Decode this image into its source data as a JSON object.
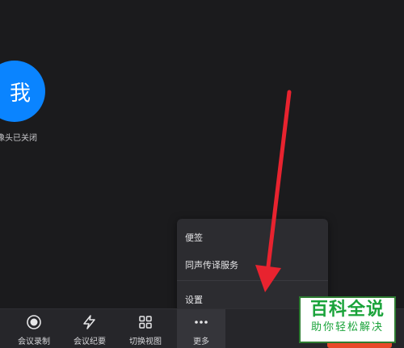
{
  "video": {
    "avatar_text": "我",
    "camera_status": "像头已关闭",
    "avatar_color": "#0a84ff"
  },
  "toolbar": {
    "items": [
      {
        "label": "会议录制",
        "icon": "record-icon"
      },
      {
        "label": "会议纪要",
        "icon": "ai-notes-icon"
      },
      {
        "label": "切换视图",
        "icon": "grid-view-icon"
      },
      {
        "label": "更多",
        "icon": "more-dots-icon"
      }
    ]
  },
  "more_menu": {
    "items": [
      {
        "label": "便签"
      },
      {
        "label": "同声传译服务"
      },
      {
        "label": "设置"
      }
    ]
  },
  "watermark": {
    "title": "百科全说",
    "subtitle": "助你轻松解决",
    "color": "#1aa33a"
  },
  "accent": {
    "arrow_color": "#e8232f",
    "button_color": "#e8492a"
  }
}
